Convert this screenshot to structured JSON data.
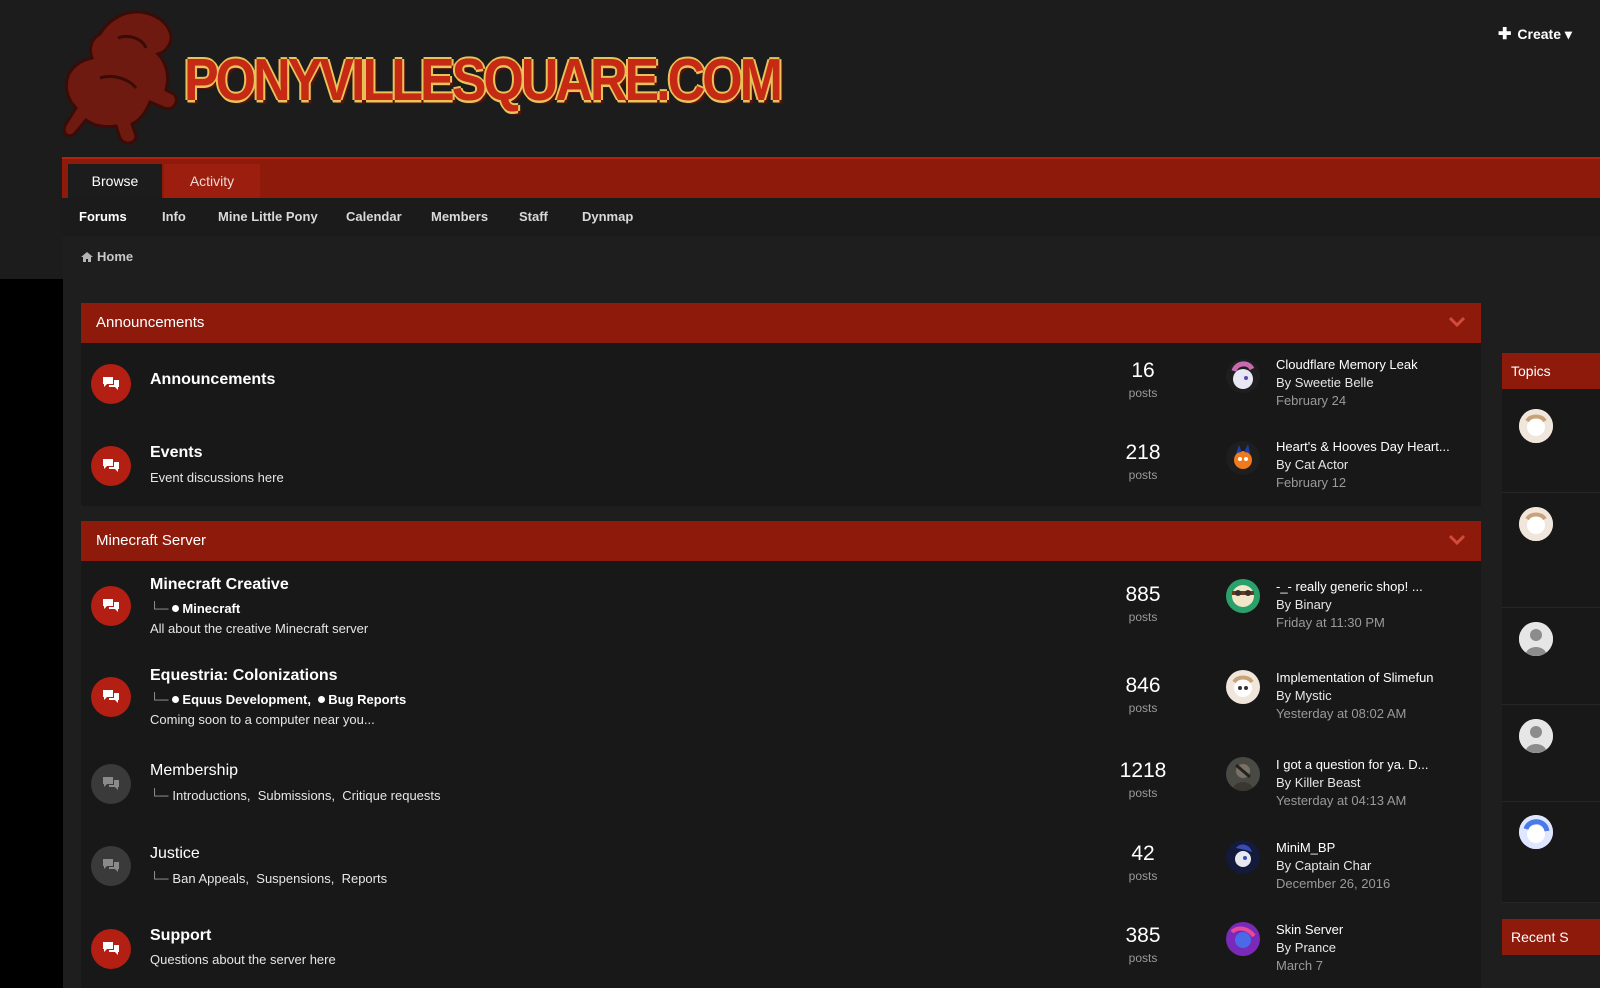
{
  "site": {
    "logo_text": "PONYVILLESQUARE.COM",
    "create_label": "Create"
  },
  "nav": {
    "tabs": [
      {
        "label": "Browse"
      },
      {
        "label": "Activity"
      }
    ],
    "subnav": [
      "Forums",
      "Info",
      "Mine Little Pony",
      "Calendar",
      "Members",
      "Staff",
      "Dynmap"
    ]
  },
  "breadcrumb": {
    "home": "Home"
  },
  "colors": {
    "accent": "#8e1a0b",
    "forum_unread": "#b31f12",
    "forum_read": "#3a3a3a",
    "background": "#1e1e1e"
  },
  "categories": [
    {
      "title": "Announcements",
      "forums": [
        {
          "name": "Announcements",
          "posts": "16",
          "posts_label": "posts",
          "last": {
            "title": "Cloudflare Memory Leak",
            "by": "By Sweetie Belle",
            "date": "February 24"
          }
        },
        {
          "name": "Events",
          "desc": "Event discussions here",
          "posts": "218",
          "posts_label": "posts",
          "last": {
            "title": "Heart's & Hooves Day Heart...",
            "by": "By Cat Actor",
            "date": "February 12"
          }
        }
      ]
    },
    {
      "title": "Minecraft Server",
      "forums": [
        {
          "name": "Minecraft Creative",
          "subforums": [
            "Minecraft"
          ],
          "desc": "All about the creative Minecraft server",
          "posts": "885",
          "posts_label": "posts",
          "last": {
            "title": "-_- really generic shop! ...",
            "by": "By Binary",
            "date": "Friday at 11:30 PM"
          }
        },
        {
          "name": "Equestria: Colonizations",
          "subforums": [
            "Equus Development,",
            "Bug Reports"
          ],
          "desc": "Coming soon to a computer near you...",
          "posts": "846",
          "posts_label": "posts",
          "last": {
            "title": "Implementation of Slimefun",
            "by": "By Mystic",
            "date": "Yesterday at 08:02 AM"
          }
        },
        {
          "name": "Membership",
          "subforums": [
            "Introductions,",
            "Submissions,",
            "Critique requests"
          ],
          "posts": "1218",
          "posts_label": "posts",
          "last": {
            "title": "I got a question for ya. D...",
            "by": "By Killer Beast",
            "date": "Yesterday at 04:13 AM"
          }
        },
        {
          "name": "Justice",
          "subforums": [
            "Ban Appeals,",
            "Suspensions,",
            "Reports"
          ],
          "posts": "42",
          "posts_label": "posts",
          "last": {
            "title": "MiniM_BP",
            "by": "By Captain Char",
            "date": "December 26, 2016"
          }
        },
        {
          "name": "Support",
          "desc": "Questions about the server here",
          "posts": "385",
          "posts_label": "posts",
          "last": {
            "title": "Skin Server",
            "by": "By Prance",
            "date": "March 7"
          }
        }
      ]
    }
  ],
  "sidebar": {
    "topics_title": "Topics",
    "recent_title": "Recent S"
  }
}
